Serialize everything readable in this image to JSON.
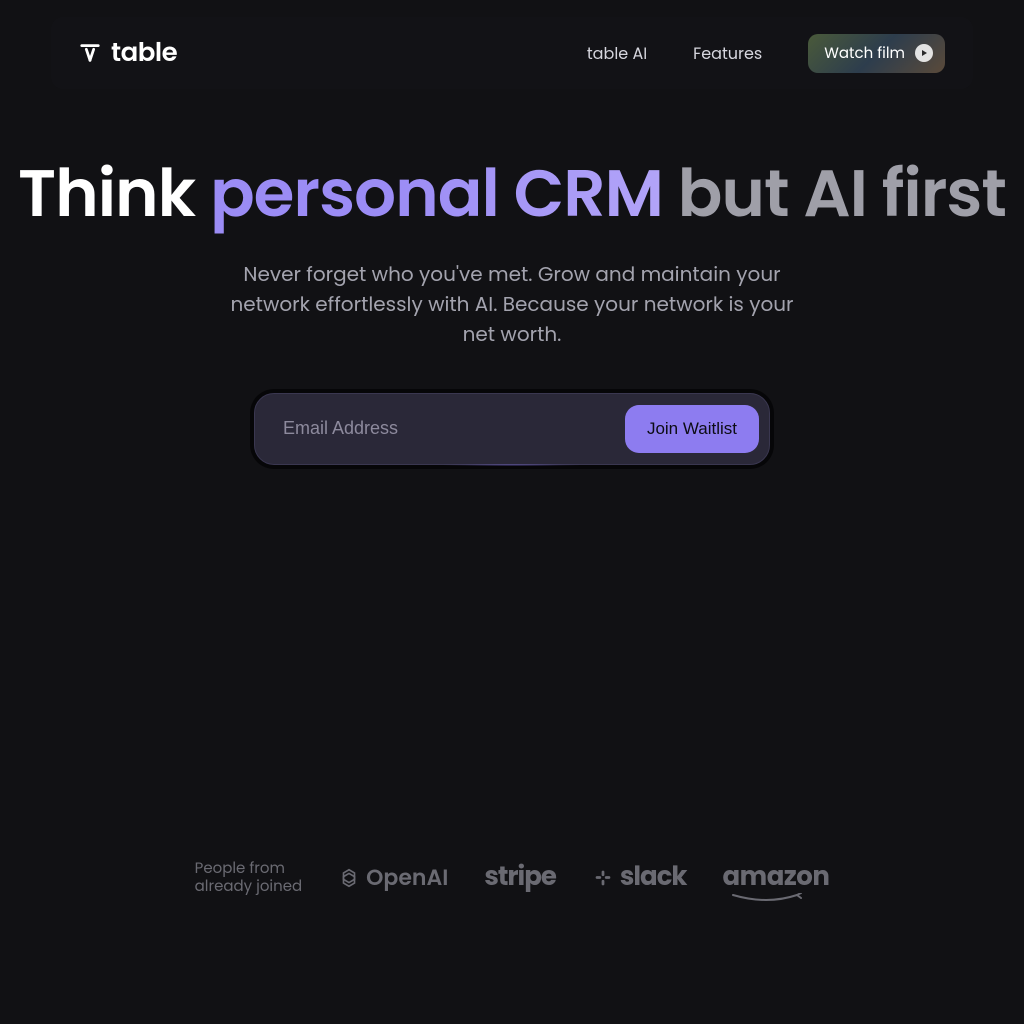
{
  "brand": {
    "name": "table"
  },
  "nav": {
    "items": [
      "table AI",
      "Features"
    ],
    "watch_film": "Watch film"
  },
  "hero": {
    "title_p1": "Think ",
    "title_p2": "personal CRM",
    "title_p3": " but AI first",
    "subtitle": "Never forget who you've met. Grow and maintain your network effortlessly with AI. Because your network is your net worth."
  },
  "form": {
    "email_placeholder": "Email Address",
    "cta": "Join Waitlist"
  },
  "social": {
    "line1": "People from",
    "line2": "already joined",
    "brands": [
      "OpenAI",
      "stripe",
      "slack",
      "amazon"
    ]
  }
}
